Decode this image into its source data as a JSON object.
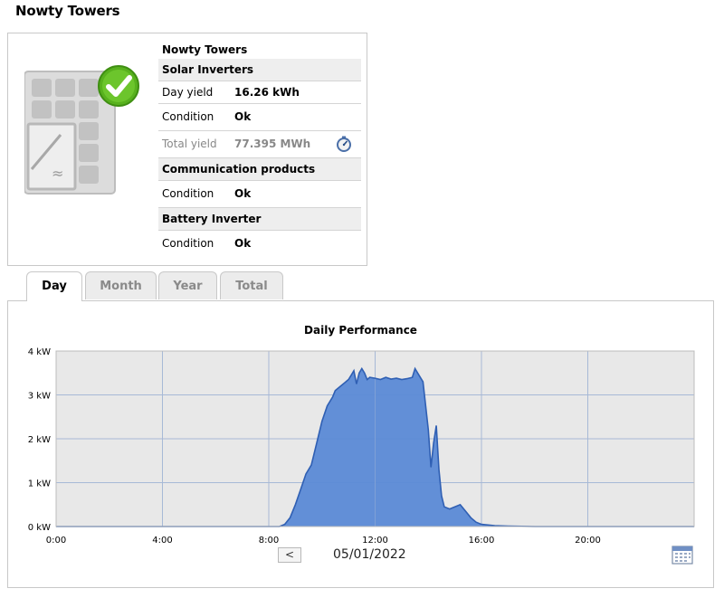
{
  "page": {
    "title": "Nowty Towers"
  },
  "plant": {
    "name": "Nowty Towers",
    "status_icon": "check-icon",
    "sections": {
      "solar": {
        "header": "Solar Inverters",
        "day_yield_label": "Day yield",
        "day_yield_value": "16.26 kWh",
        "condition_label": "Condition",
        "condition_value": "Ok",
        "total_yield_label": "Total yield",
        "total_yield_value": "77.395 MWh",
        "total_yield_icon": "gauge-icon"
      },
      "communication": {
        "header": "Communication products",
        "condition_label": "Condition",
        "condition_value": "Ok"
      },
      "battery": {
        "header": "Battery Inverter",
        "condition_label": "Condition",
        "condition_value": "Ok"
      }
    }
  },
  "tabs": [
    {
      "label": "Day",
      "active": true
    },
    {
      "label": "Month",
      "active": false
    },
    {
      "label": "Year",
      "active": false
    },
    {
      "label": "Total",
      "active": false
    }
  ],
  "nav": {
    "prev_label": "<",
    "date": "05/01/2022",
    "calendar_icon": "calendar-icon"
  },
  "colors": {
    "area_fill": "#5b8ad6",
    "area_stroke": "#2f5fb3",
    "plot_bg": "#e8e8e8",
    "grid": "#a7b9d6"
  },
  "chart_data": {
    "type": "area",
    "title": "Daily Performance",
    "xlabel": "",
    "ylabel": "",
    "x_ticks": [
      "0:00",
      "4:00",
      "8:00",
      "12:00",
      "16:00",
      "20:00"
    ],
    "y_ticks": [
      "0 kW",
      "1 kW",
      "2 kW",
      "3 kW",
      "4 kW"
    ],
    "xlim": [
      0,
      24
    ],
    "ylim": [
      0,
      4
    ],
    "grid": true,
    "legend": "none",
    "series": [
      {
        "x": [
          0,
          8.4,
          8.6,
          8.8,
          9.0,
          9.2,
          9.4,
          9.6,
          9.8,
          10.0,
          10.2,
          10.4,
          10.5,
          10.6,
          10.8,
          11.0,
          11.1,
          11.2,
          11.3,
          11.4,
          11.5,
          11.6,
          11.7,
          11.8,
          12.0,
          12.2,
          12.4,
          12.6,
          12.8,
          13.0,
          13.2,
          13.4,
          13.5,
          13.6,
          13.8,
          14.0,
          14.1,
          14.2,
          14.3,
          14.4,
          14.5,
          14.6,
          14.8,
          15.0,
          15.2,
          15.4,
          15.6,
          15.8,
          16.0,
          16.5,
          17.0,
          18.0,
          24
        ],
        "y": [
          0,
          0,
          0.05,
          0.2,
          0.5,
          0.85,
          1.2,
          1.4,
          1.9,
          2.4,
          2.75,
          2.95,
          3.1,
          3.15,
          3.25,
          3.35,
          3.45,
          3.55,
          3.25,
          3.5,
          3.6,
          3.5,
          3.35,
          3.4,
          3.38,
          3.35,
          3.4,
          3.36,
          3.38,
          3.35,
          3.37,
          3.4,
          3.6,
          3.5,
          3.3,
          2.2,
          1.35,
          1.9,
          2.3,
          1.3,
          0.7,
          0.45,
          0.4,
          0.45,
          0.5,
          0.35,
          0.2,
          0.1,
          0.05,
          0.02,
          0.01,
          0,
          0
        ]
      }
    ]
  }
}
